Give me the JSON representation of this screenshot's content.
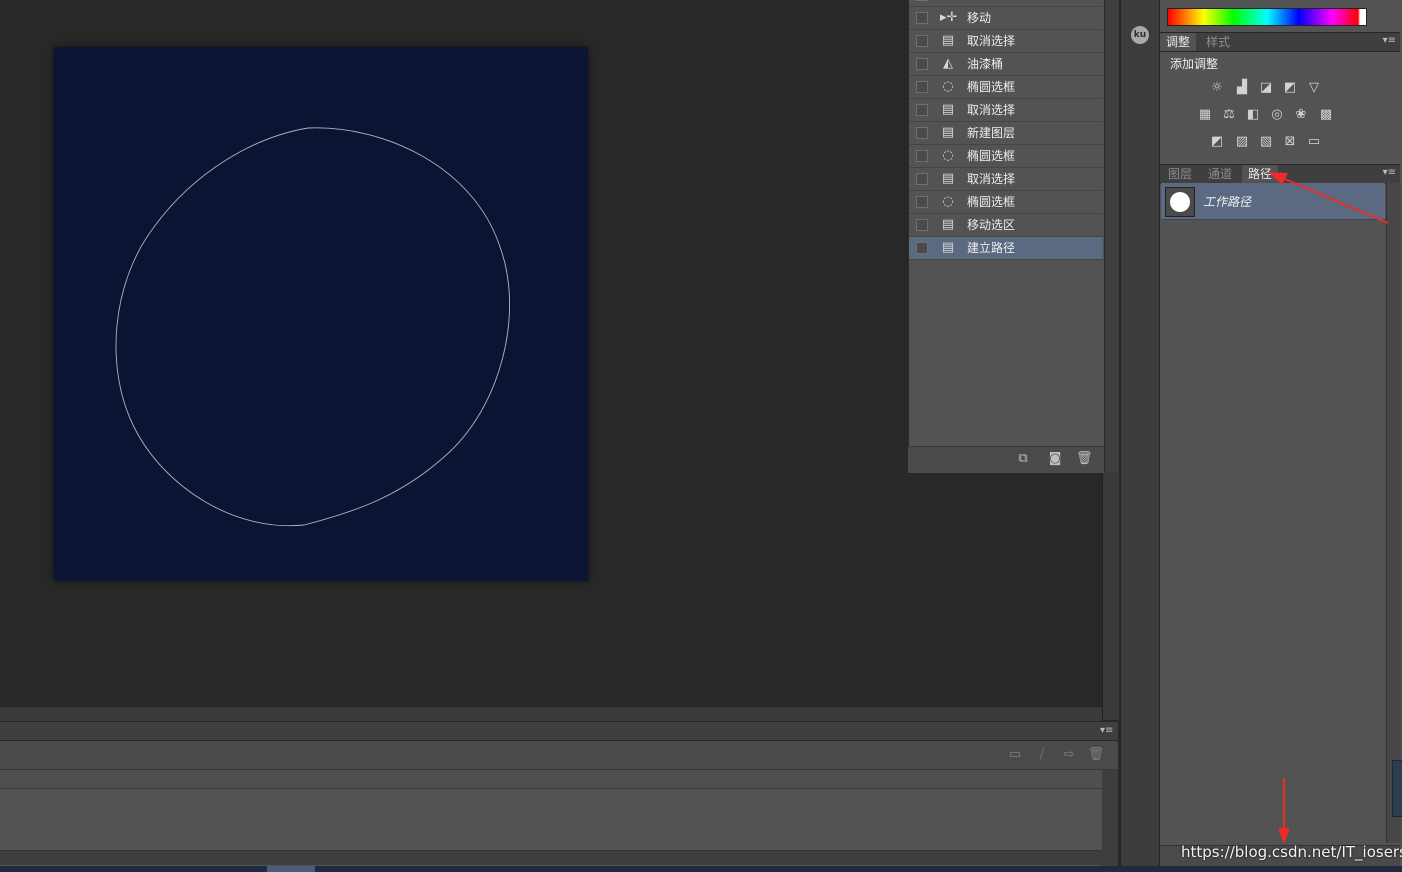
{
  "history": {
    "items": [
      {
        "label": "移动",
        "icon": "move-arrow-icon",
        "selected": false
      },
      {
        "label": "取消选择",
        "icon": "document-icon",
        "selected": false
      },
      {
        "label": "油漆桶",
        "icon": "paint-bucket-icon",
        "selected": false
      },
      {
        "label": "椭圆选框",
        "icon": "ellipse-marquee-icon",
        "selected": false
      },
      {
        "label": "取消选择",
        "icon": "document-icon",
        "selected": false
      },
      {
        "label": "新建图层",
        "icon": "document-icon",
        "selected": false
      },
      {
        "label": "椭圆选框",
        "icon": "ellipse-marquee-icon",
        "selected": false
      },
      {
        "label": "取消选择",
        "icon": "document-icon",
        "selected": false
      },
      {
        "label": "椭圆选框",
        "icon": "ellipse-marquee-icon",
        "selected": false
      },
      {
        "label": "移动选区",
        "icon": "document-icon",
        "selected": false
      },
      {
        "label": "建立路径",
        "icon": "document-icon",
        "selected": true
      }
    ]
  },
  "dock": {
    "ku_label": "ku"
  },
  "adjustments": {
    "tabs": [
      "调整",
      "样式"
    ],
    "title": "添加调整"
  },
  "layers_panel": {
    "tabs": [
      "图层",
      "通道",
      "路径"
    ],
    "active_tab": "路径",
    "paths": [
      {
        "name": "工作路径"
      }
    ]
  },
  "colors": {
    "canvas_bg": "#0b1533",
    "selection_highlight": "#5b6a80",
    "annotation_arrow": "#ee2a2a"
  },
  "watermark": "https://blog.csdn.net/IT_iosers"
}
